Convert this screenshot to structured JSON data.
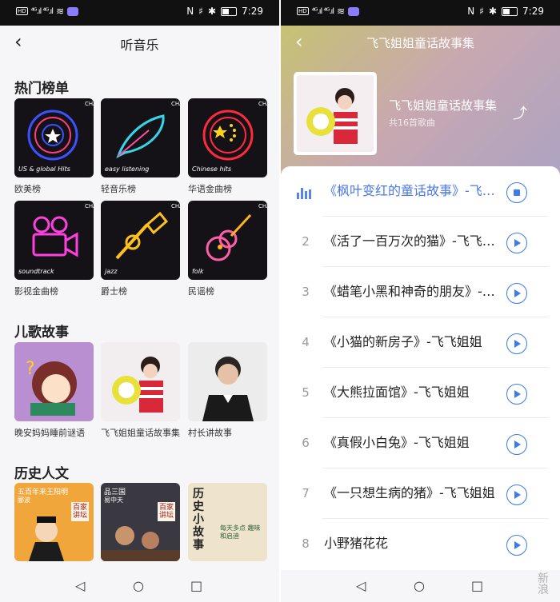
{
  "status": {
    "hd1": "HD",
    "hd2": "HD",
    "sig": "⁴ᴳ.ıl ⁴ᴳ.ıl",
    "nfc": "N",
    "vib": "♯",
    "bt": "✱",
    "time": "7:29"
  },
  "left": {
    "title": "听音乐",
    "sections": {
      "charts": "热门榜单",
      "kids": "儿歌故事",
      "history": "历史人文"
    },
    "charts": [
      {
        "caption": "欧美榜",
        "tag": "US & global Hits",
        "color": "#3b52ff"
      },
      {
        "caption": "轻音乐榜",
        "tag": "easy listening",
        "color": "#35d6e8"
      },
      {
        "caption": "华语金曲榜",
        "tag": "Chinese hits",
        "color": "#ff2a3c"
      },
      {
        "caption": "影视金曲榜",
        "tag": "soundtrack",
        "color": "#ff3fe0"
      },
      {
        "caption": "爵士榜",
        "tag": "jazz",
        "color": "#ffc21a"
      },
      {
        "caption": "民谣榜",
        "tag": "folk",
        "color": "#ff5fa8"
      }
    ],
    "chart_brand": "CHARTS",
    "kids": [
      {
        "caption": "晚安妈妈睡前谜语"
      },
      {
        "caption": "飞飞姐姐童话故事集"
      },
      {
        "caption": "村长讲故事"
      }
    ],
    "history": [
      {
        "caption": "",
        "line1": "五百年来王阳明",
        "line2": "郦波",
        "badge": "百家讲坛"
      },
      {
        "caption": "",
        "line1": "品三国",
        "line2": "易中天",
        "badge": "百家讲坛"
      },
      {
        "caption": "",
        "line1": "历史小故事",
        "line2": "每天多点 趣味和启迪",
        "badge": ""
      }
    ]
  },
  "right": {
    "title": "飞飞姐姐童话故事集",
    "album_name": "飞飞姐姐童话故事集",
    "album_count": "共16首歌曲",
    "songs": [
      {
        "num": "",
        "title": "《枫叶变红的童话故事》-飞飞姐姐",
        "playing": true
      },
      {
        "num": "2",
        "title": "《活了一百万次的猫》-飞飞姐姐",
        "playing": false
      },
      {
        "num": "3",
        "title": "《蜡笔小黑和神奇的朋友》-飞飞姐姐",
        "playing": false
      },
      {
        "num": "4",
        "title": "《小猫的新房子》-飞飞姐姐",
        "playing": false
      },
      {
        "num": "5",
        "title": "《大熊拉面馆》-飞飞姐姐",
        "playing": false
      },
      {
        "num": "6",
        "title": "《真假小白兔》-飞飞姐姐",
        "playing": false
      },
      {
        "num": "7",
        "title": "《一只想生病的猪》-飞飞姐姐",
        "playing": false
      },
      {
        "num": "8",
        "title": "小野猪花花",
        "playing": false
      }
    ],
    "watermark": "新\n浪"
  },
  "nav": {
    "back": "◁",
    "home": "○",
    "recent": "□"
  },
  "colors": {
    "accent": "#3b7bea",
    "playing": "#4a78e6"
  }
}
